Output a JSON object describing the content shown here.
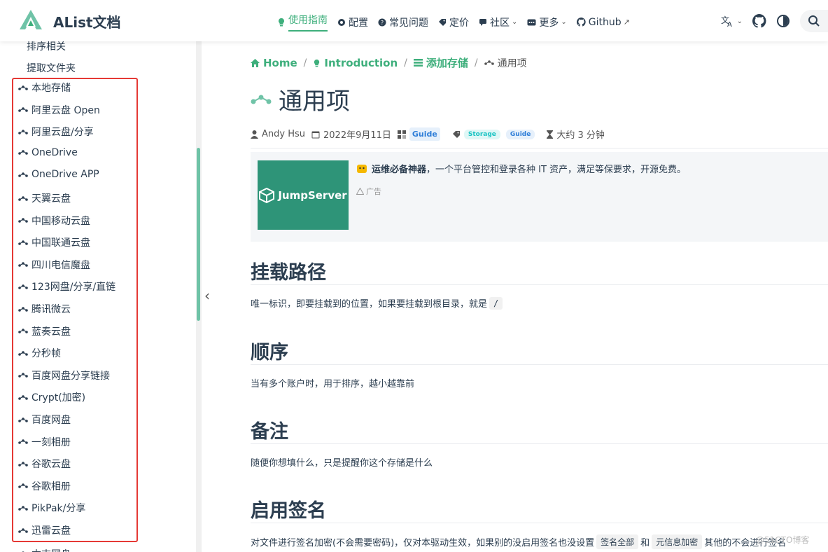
{
  "navbar": {
    "site_title": "AList文档",
    "links": [
      {
        "label": "使用指南",
        "icon": "lightbulb-icon",
        "active": true
      },
      {
        "label": "配置",
        "icon": "gear-icon"
      },
      {
        "label": "常见问题",
        "icon": "question-icon"
      },
      {
        "label": "定价",
        "icon": "tag-icon"
      },
      {
        "label": "社区",
        "icon": "chat-icon",
        "dropdown": true
      },
      {
        "label": "更多",
        "icon": "more-icon",
        "dropdown": true
      },
      {
        "label": "Github",
        "icon": "github-icon",
        "external": true
      }
    ]
  },
  "sidebar": {
    "top_items": [
      "排序相关",
      "提取文件夹"
    ],
    "items": [
      "本地存储",
      "阿里云盘 Open",
      "阿里云盘/分享",
      "OneDrive",
      "OneDrive APP",
      "天翼云盘",
      "中国移动云盘",
      "中国联通云盘",
      "四川电信魔盘",
      "123网盘/分享/直链",
      "腾讯微云",
      "蓝奏云盘",
      "分秒帧",
      "百度网盘分享链接",
      "Crypt(加密)",
      "百度网盘",
      "一刻相册",
      "谷歌云盘",
      "谷歌相册",
      "PikPak/分享",
      "迅雷云盘"
    ],
    "partial_item": "本吉网盘"
  },
  "breadcrumb": [
    {
      "label": "Home",
      "icon": "home-icon"
    },
    {
      "label": "Introduction",
      "icon": "lightbulb-icon"
    },
    {
      "label": "添加存储",
      "icon": "list-icon"
    },
    {
      "label": "通用项",
      "icon": "storage-chain-icon"
    }
  ],
  "page": {
    "title": "通用项",
    "author": "Andy Hsu",
    "date": "2022年9月11日",
    "category": "Guide",
    "tags": [
      "Storage",
      "Guide"
    ],
    "read_time": "大约 3 分钟"
  },
  "ad": {
    "brand": "JumpServer",
    "headline": "运维必备神器",
    "text": "，一个平台管控和登录各种 IT 资产，满足等保要求，开源免费。",
    "label": "广告"
  },
  "sections": [
    {
      "heading": "挂载路径",
      "text": "唯一标识，即要挂载到的位置，如果要挂载到根目录，就是",
      "code": "/"
    },
    {
      "heading": "顺序",
      "text": "当有多个账户时，用于排序，越小越靠前"
    },
    {
      "heading": "备注",
      "text": "随便你想填什么，只是提醒你这个存储是什么"
    },
    {
      "heading": "启用签名",
      "text_a": "对文件进行签名加密(不会需要密码)，仅对本驱动生效，如果别的没启用签名也没设置",
      "code_a": "签名全部",
      "mid": "和",
      "code_b": "元信息加密",
      "text_b": "其他的不会进行签名"
    }
  ],
  "watermark": "@51CTO博客",
  "colors": {
    "accent": "#3eaf7c",
    "highlight_border": "#e53935",
    "ad_bg": "#2e9478"
  }
}
